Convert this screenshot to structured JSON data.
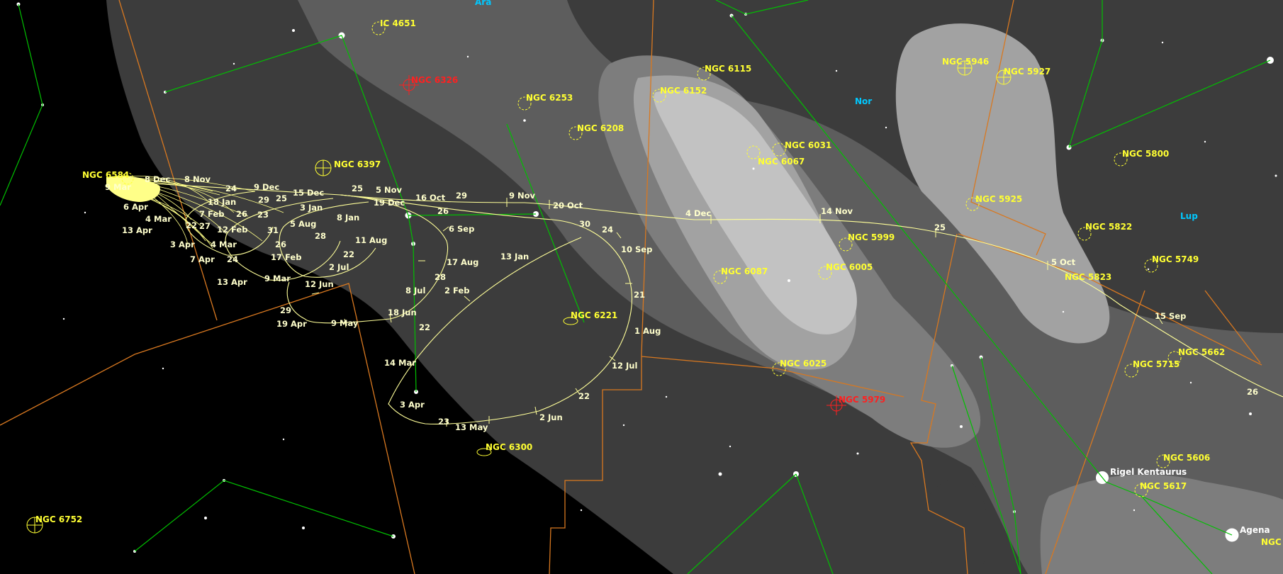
{
  "colors": {
    "background": "#000000",
    "milky_way": [
      "#3c3c3c",
      "#5d5d5d",
      "#7d7d7d",
      "#a2a2a2",
      "#c2c2c2"
    ],
    "constellation_lines": "#00c000",
    "boundaries": "#d87820",
    "track": "#ffff99",
    "dso": "#ffff33",
    "dso_highlight": "#ff2020",
    "star_label": "#ffffff",
    "constellation_label": "#00c8ff"
  },
  "constellation_labels": [
    "Ara",
    "Nor",
    "Lup"
  ],
  "star_labels": [
    "Rigel Kentaurus",
    "Agena"
  ],
  "dso_labels": {
    "ic4651": "IC 4651",
    "ngc6326": "NGC 6326",
    "ngc6253": "NGC 6253",
    "ngc6208": "NGC 6208",
    "ngc6115": "NGC 6115",
    "ngc6152": "NGC 6152",
    "ngc6031": "NGC 6031",
    "ngc6067": "NGC 6067",
    "ngc5946": "NGC 5946",
    "ngc5927": "NGC 5927",
    "ngc5800": "NGC 5800",
    "ngc5925": "NGC 5925",
    "ngc5822": "NGC 5822",
    "ngc5749": "NGC 5749",
    "ngc5999": "NGC 5999",
    "ngc6087": "NGC 6087",
    "ngc6005": "NGC 6005",
    "ngc5823": "NGC 5823",
    "ngc6221": "NGC 6221",
    "ngc6584": "NGC 6584",
    "ngc6397": "NGC 6397",
    "ngc6025": "NGC 6025",
    "ngc5979": "NGC 5979",
    "ngc5715": "NGC 5715",
    "ngc5662": "NGC 5662",
    "ngc6300": "NGC 6300",
    "ngc5606": "NGC 5606",
    "ngc5617": "NGC 5617",
    "ngc6752": "NGC 6752",
    "ngc_edge": "NGC"
  },
  "track_labels": [
    "8 Dec",
    "8 Nov",
    "9 Mar",
    "24",
    "9 Dec",
    "15 Dec",
    "25",
    "5 Nov",
    "19 Dec",
    "16 Oct",
    "29",
    "9 Nov",
    "20 Oct",
    "4 Dec",
    "14 Nov",
    "25",
    "5 Oct",
    "NGC 5823",
    "15 Sep",
    "26",
    "6 Apr",
    "18 Jan",
    "29",
    "25",
    "3 Jan",
    "8 Jan",
    "26",
    "6 Sep",
    "4 Mar",
    "7 Feb",
    "26",
    "23",
    "5 Aug",
    "11 Aug",
    "30",
    "24",
    "13 Apr",
    "22",
    "27",
    "12 Feb",
    "31",
    "28",
    "10 Sep",
    "3 Apr",
    "4 Mar",
    "26",
    "22",
    "13 Jan",
    "17 Aug",
    "7 Apr",
    "24",
    "17 Feb",
    "2 Jul",
    "28",
    "21",
    "13 Apr",
    "9 Mar",
    "12 Jun",
    "8 Jul",
    "2 Feb",
    "29",
    "18 Jun",
    "1 Aug",
    "19 Apr",
    "9 May",
    "22",
    "12 Jul",
    "14 Mar",
    "22",
    "3 Apr",
    "23",
    "13 May",
    "2 Jun"
  ]
}
